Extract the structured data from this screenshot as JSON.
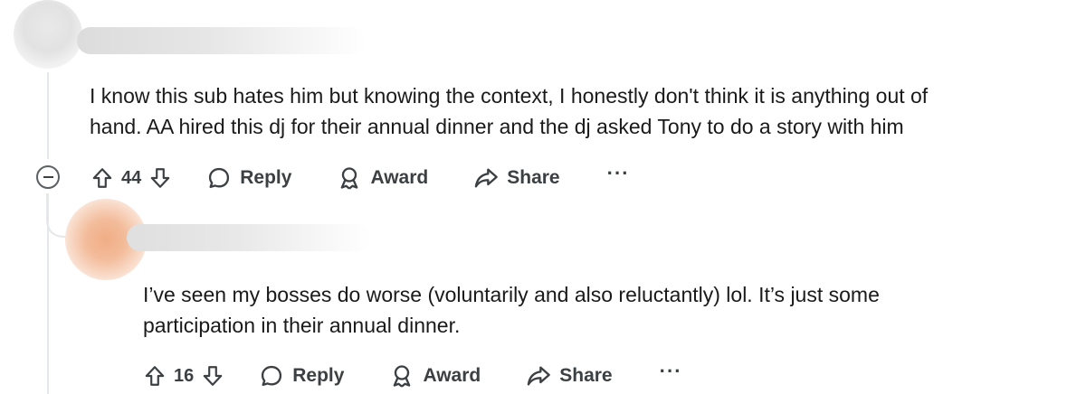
{
  "comments": [
    {
      "body": [
        "I know this sub hates him but knowing the context, I honestly don't think it is anything out of",
        "hand. AA hired this dj for their annual dinner and the dj asked Tony to do a story with him"
      ],
      "votes": "44",
      "actions": {
        "reply": "Reply",
        "award": "Award",
        "share": "Share",
        "more": "···"
      },
      "avatar_color": "#dcdcdc"
    },
    {
      "body": [
        "I’ve seen my bosses do worse (voluntarily and also reluctantly) lol. It’s just some",
        "participation in their annual dinner."
      ],
      "votes": "16",
      "actions": {
        "reply": "Reply",
        "award": "Award",
        "share": "Share",
        "more": "···"
      },
      "avatar_color": "#f2b48f"
    }
  ],
  "icons": [
    "upvote-icon",
    "downvote-icon",
    "reply-icon",
    "award-icon",
    "share-icon",
    "collapse-icon"
  ]
}
